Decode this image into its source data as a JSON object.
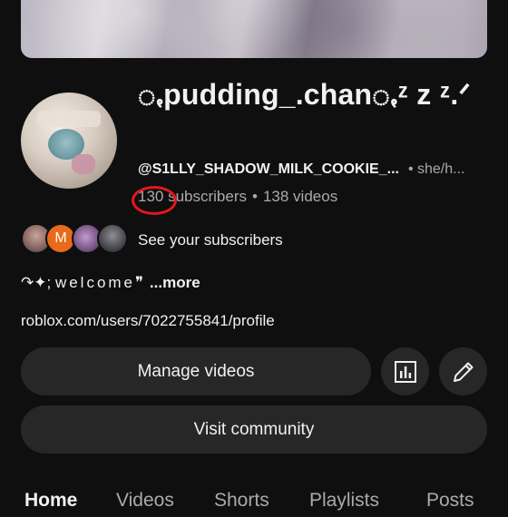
{
  "channel": {
    "title": "ꩻpudding_.chanꩻᶻ z ᶻ.ᐟ",
    "handle": "@S1LLY_SHADOW_MILK_COOKIE_...",
    "pronouns": "• she/h...",
    "subscribers": "130 subscribers",
    "separator": "•",
    "videos": "138 videos",
    "see_subscribers": "See your subscribers",
    "mini_avatar_letter": "M",
    "description_prefix": "↷✦; ",
    "description_welcome": "welcome",
    "description_quote": "❞",
    "description_more": " ...more",
    "link": "roblox.com/users/7022755841/profile"
  },
  "buttons": {
    "manage_videos": "Manage videos",
    "visit_community": "Visit community"
  },
  "icons": {
    "analytics": "analytics-icon",
    "edit": "edit-pencil-icon"
  },
  "tabs": [
    {
      "label": "Home",
      "active": true
    },
    {
      "label": "Videos",
      "active": false
    },
    {
      "label": "Shorts",
      "active": false
    },
    {
      "label": "Playlists",
      "active": false
    },
    {
      "label": "Posts",
      "active": false
    }
  ],
  "colors": {
    "background": "#0f0f0f",
    "button": "#272727",
    "secondary_text": "#aaaaaa",
    "annotation_circle": "#e4161d",
    "mini_avatar_orange": "#e86a1a"
  }
}
